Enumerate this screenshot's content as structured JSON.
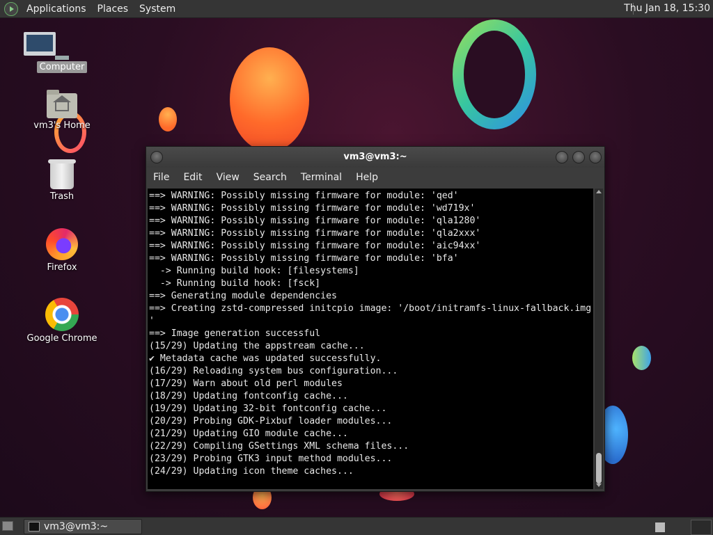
{
  "top_panel": {
    "menus": [
      "Applications",
      "Places",
      "System"
    ],
    "clock": "Thu Jan 18, 15:30"
  },
  "desktop_icons": [
    {
      "label": "Computer",
      "icon": "computer-icon"
    },
    {
      "label": "vm3's Home",
      "icon": "home-folder-icon"
    },
    {
      "label": "Trash",
      "icon": "trash-icon"
    },
    {
      "label": "Firefox",
      "icon": "firefox-icon"
    },
    {
      "label": "Google Chrome",
      "icon": "chrome-icon"
    }
  ],
  "terminal": {
    "title": "vm3@vm3:~",
    "menu": [
      "File",
      "Edit",
      "View",
      "Search",
      "Terminal",
      "Help"
    ],
    "lines": [
      "==> WARNING: Possibly missing firmware for module: 'qed'",
      "==> WARNING: Possibly missing firmware for module: 'wd719x'",
      "==> WARNING: Possibly missing firmware for module: 'qla1280'",
      "==> WARNING: Possibly missing firmware for module: 'qla2xxx'",
      "==> WARNING: Possibly missing firmware for module: 'aic94xx'",
      "==> WARNING: Possibly missing firmware for module: 'bfa'",
      "  -> Running build hook: [filesystems]",
      "  -> Running build hook: [fsck]",
      "==> Generating module dependencies",
      "==> Creating zstd-compressed initcpio image: '/boot/initramfs-linux-fallback.img",
      "'",
      "==> Image generation successful",
      "(15/29) Updating the appstream cache...",
      "✔ Metadata cache was updated successfully.",
      "(16/29) Reloading system bus configuration...",
      "(17/29) Warn about old perl modules",
      "(18/29) Updating fontconfig cache...",
      "(19/29) Updating 32-bit fontconfig cache...",
      "(20/29) Probing GDK-Pixbuf loader modules...",
      "(21/29) Updating GIO module cache...",
      "(22/29) Compiling GSettings XML schema files...",
      "(23/29) Probing GTK3 input method modules...",
      "(24/29) Updating icon theme caches..."
    ]
  },
  "bottom_panel": {
    "task_label": "vm3@vm3:~"
  }
}
